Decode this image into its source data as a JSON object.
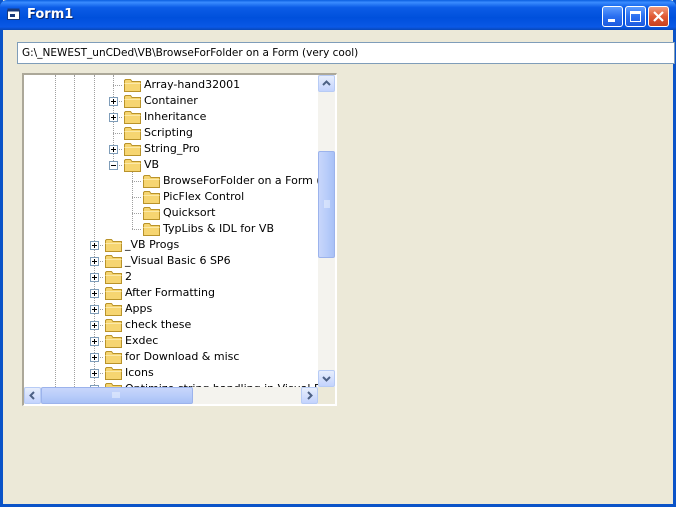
{
  "window": {
    "title": "Form1"
  },
  "path_box": {
    "value": "G:\\_NEWEST_unCDed\\VB\\BrowseForFolder on a Form (very cool)"
  },
  "tree": {
    "nodes": [
      {
        "label": "Array-hand32001",
        "expander": "none"
      },
      {
        "label": "Container",
        "expander": "plus"
      },
      {
        "label": "Inheritance",
        "expander": "plus"
      },
      {
        "label": "Scripting",
        "expander": "none"
      },
      {
        "label": "String_Pro",
        "expander": "plus"
      },
      {
        "label": "VB",
        "expander": "minus"
      },
      {
        "label": "BrowseForFolder on a Form (very cool)",
        "expander": "none"
      },
      {
        "label": "PicFlex Control",
        "expander": "none"
      },
      {
        "label": "Quicksort",
        "expander": "none"
      },
      {
        "label": "TypLibs & IDL for VB",
        "expander": "none"
      },
      {
        "label": "_VB Progs",
        "expander": "plus"
      },
      {
        "label": "_Visual Basic 6 SP6",
        "expander": "plus"
      },
      {
        "label": "2",
        "expander": "plus"
      },
      {
        "label": "After Formatting",
        "expander": "plus"
      },
      {
        "label": "Apps",
        "expander": "plus"
      },
      {
        "label": "check these",
        "expander": "plus"
      },
      {
        "label": "Exdec",
        "expander": "plus"
      },
      {
        "label": "for Download & misc",
        "expander": "plus"
      },
      {
        "label": "Icons",
        "expander": "plus"
      },
      {
        "label": "Optimize string handling in Visual Basic",
        "expander": "plus"
      }
    ]
  },
  "colors": {
    "titlebar": "#0054E3",
    "window_bg": "#ECE9D8",
    "folder": "#F6D571"
  },
  "icons": {
    "app": "app-icon",
    "minimize": "minimize-icon",
    "maximize": "maximize-icon",
    "close": "close-icon",
    "folder": "folder-icon",
    "scroll_up": "arrow-up-icon",
    "scroll_down": "arrow-down-icon",
    "scroll_left": "arrow-left-icon",
    "scroll_right": "arrow-right-icon"
  }
}
